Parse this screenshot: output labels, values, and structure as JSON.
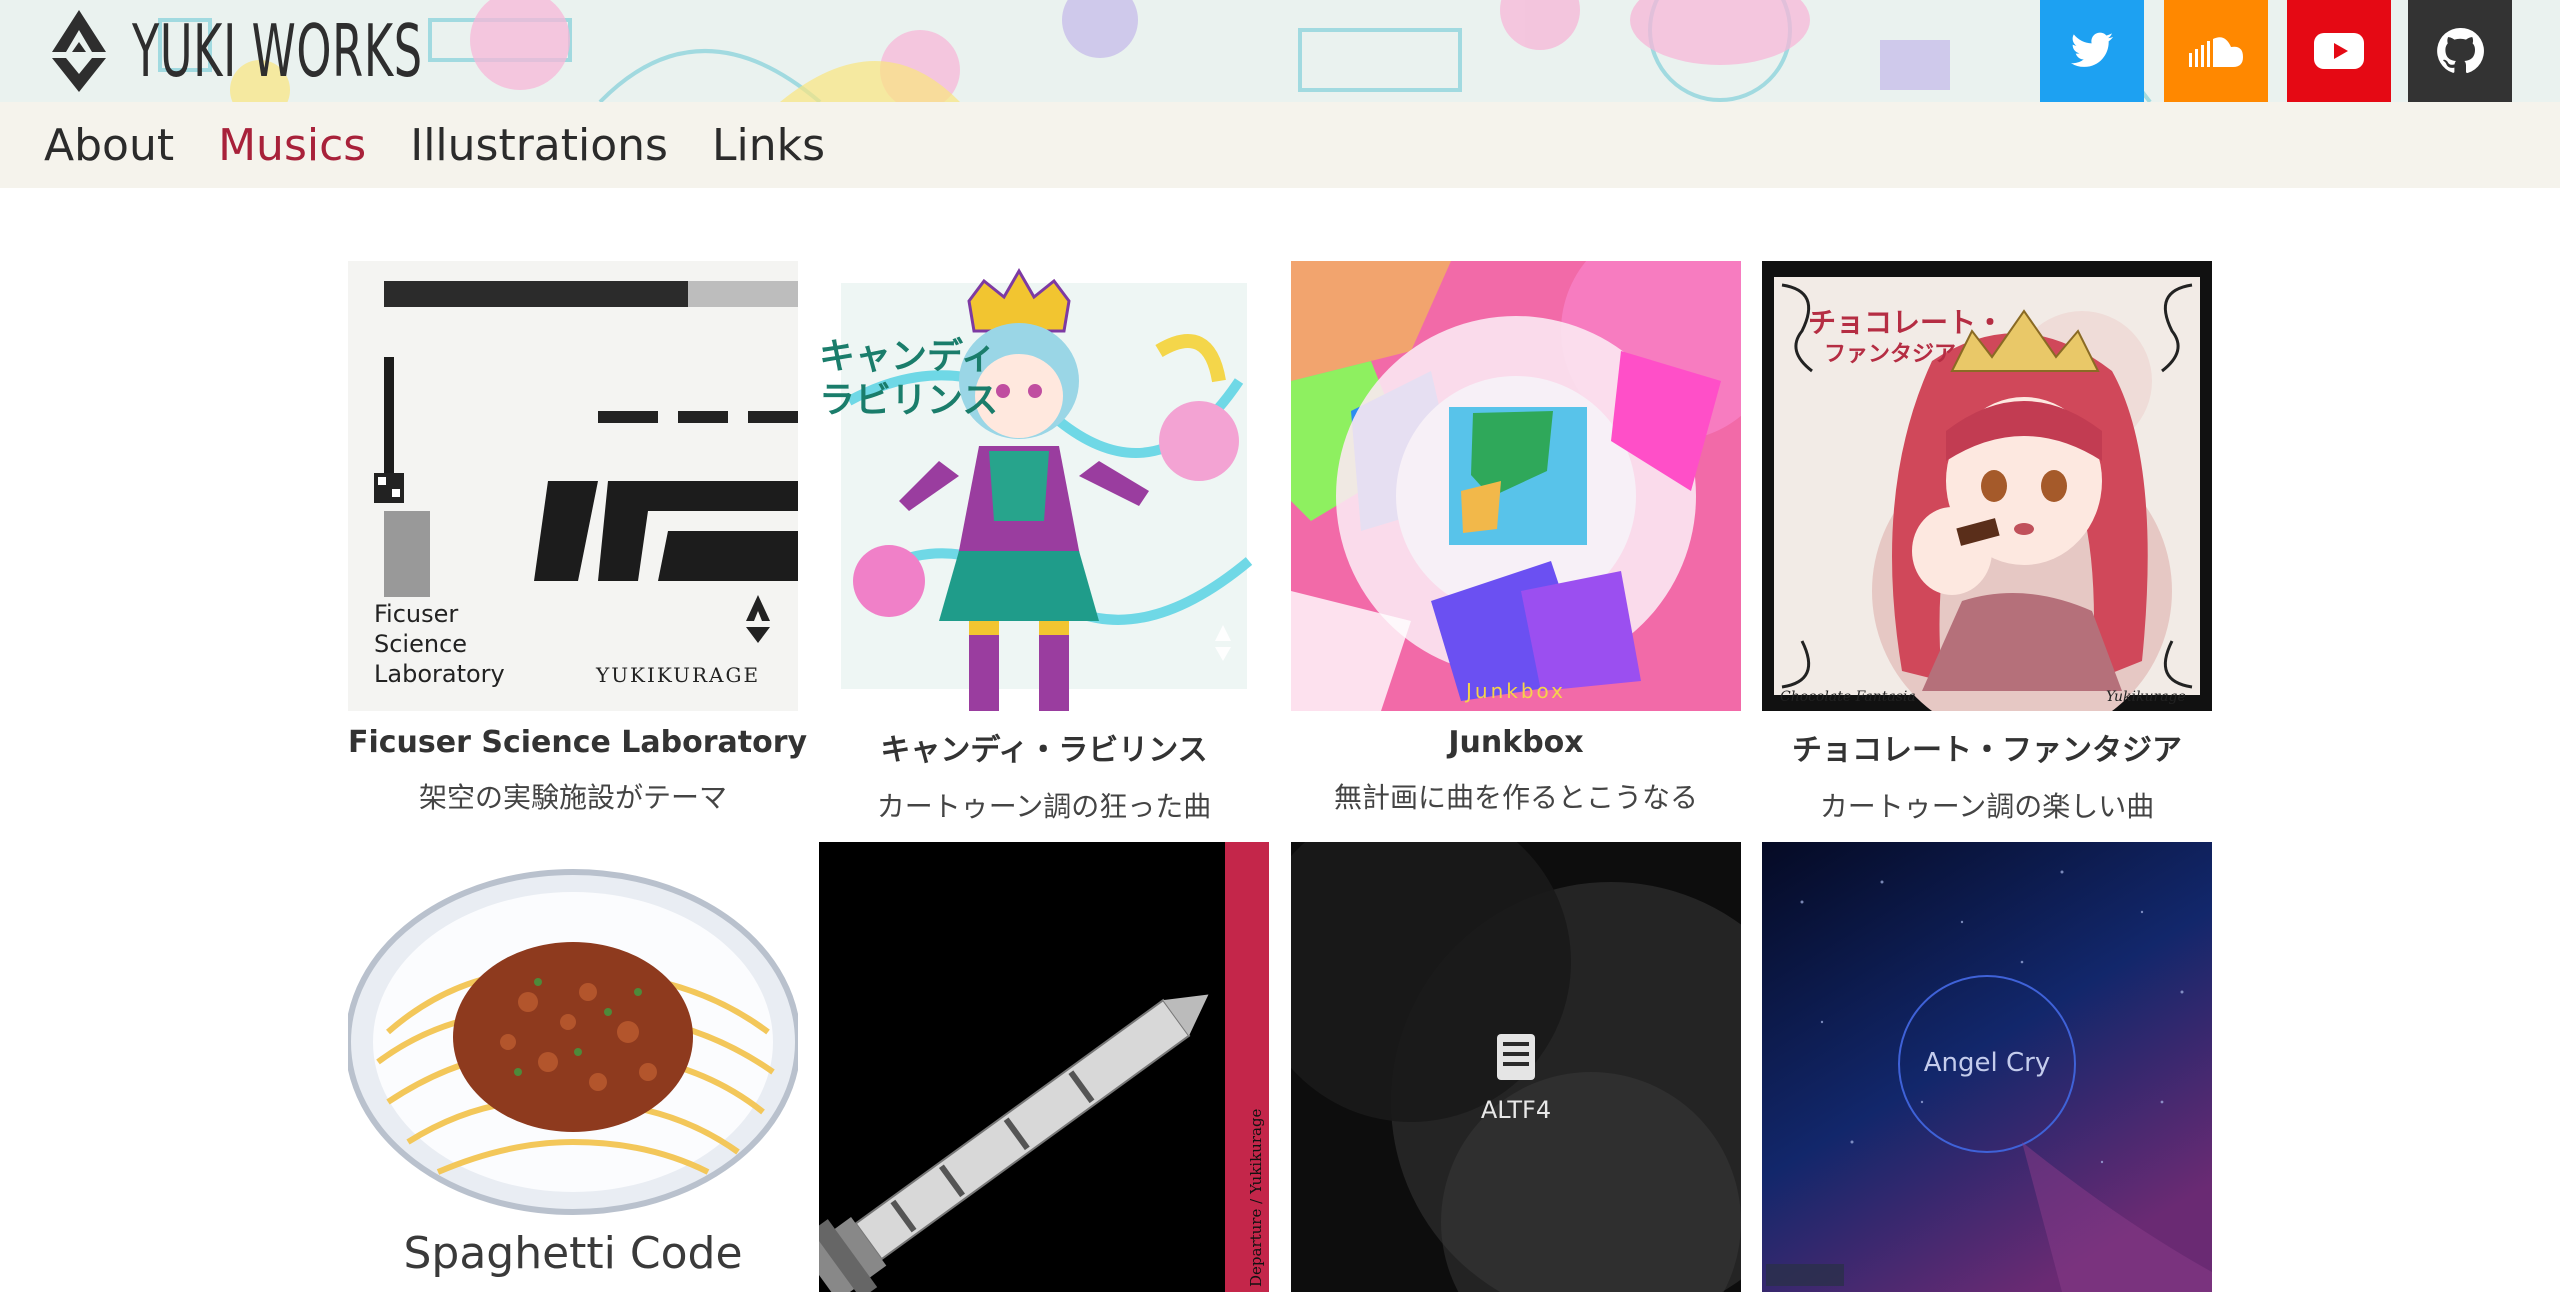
{
  "site": {
    "logo_text": "YUKI WORKS"
  },
  "social": [
    {
      "name": "twitter",
      "icon": "twitter-icon",
      "color": "#1da1f2"
    },
    {
      "name": "soundcloud",
      "icon": "soundcloud-icon",
      "color": "#ff8800"
    },
    {
      "name": "youtube",
      "icon": "youtube-icon",
      "color": "#e50914"
    },
    {
      "name": "github",
      "icon": "github-icon",
      "color": "#333333"
    }
  ],
  "nav": {
    "items": [
      {
        "label": "About"
      },
      {
        "label": "Musics"
      },
      {
        "label": "Illustrations"
      },
      {
        "label": "Links"
      }
    ],
    "active": "Musics",
    "active_color": "#a8213a"
  },
  "works": [
    {
      "title": "Ficuser Science Laboratory",
      "desc": "架空の実験施設がテーマ",
      "art_text": [
        "Ficuser",
        "Science",
        "Laboratory"
      ],
      "art_brand": "YUKIKURAGE"
    },
    {
      "title": "キャンディ・ラビリンス",
      "desc": "カートゥーン調の狂った曲",
      "art_text": [
        "キャンディ",
        "ラビリンス"
      ]
    },
    {
      "title": "Junkbox",
      "desc": "無計画に曲を作るとこうなる",
      "art_text": [
        "Junkbox"
      ]
    },
    {
      "title": "チョコレート・ファンタジア",
      "desc": "カートゥーン調の楽しい曲",
      "art_text": [
        "チョコレート・",
        "ファンタジア",
        "Chocolate Fantasia",
        "Yukikurage"
      ]
    },
    {
      "title": "",
      "desc": "",
      "art_text": [
        "Spaghetti Code"
      ]
    },
    {
      "title": "",
      "desc": "",
      "art_text": [
        "Departure / Yukikurage"
      ]
    },
    {
      "title": "",
      "desc": "",
      "art_text": [
        "ALTF4"
      ]
    },
    {
      "title": "",
      "desc": "",
      "art_text": [
        "Angel Cry"
      ]
    }
  ]
}
